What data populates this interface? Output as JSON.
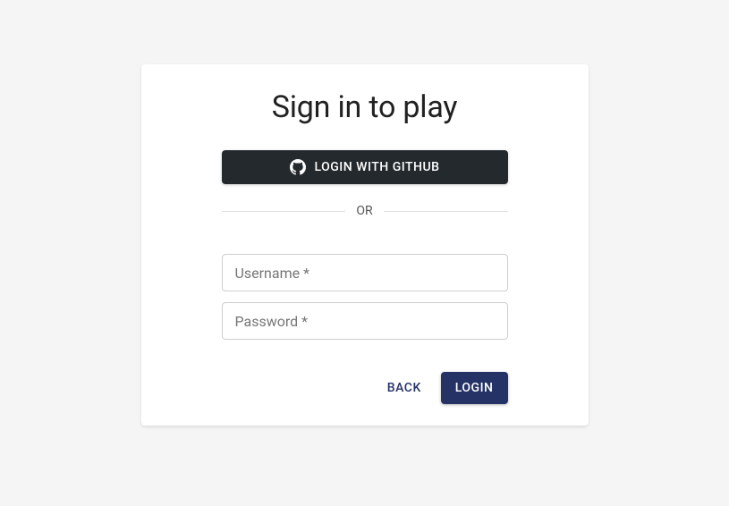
{
  "title": "Sign in to play",
  "github_button": {
    "label": "LOGIN WITH GITHUB"
  },
  "divider_text": "OR",
  "form": {
    "username": {
      "placeholder": "Username *",
      "value": ""
    },
    "password": {
      "placeholder": "Password *",
      "value": ""
    }
  },
  "actions": {
    "back_label": "BACK",
    "login_label": "LOGIN"
  },
  "colors": {
    "github_bg": "#24292e",
    "primary": "#253266",
    "card_bg": "#ffffff",
    "page_bg": "#f5f5f5"
  }
}
